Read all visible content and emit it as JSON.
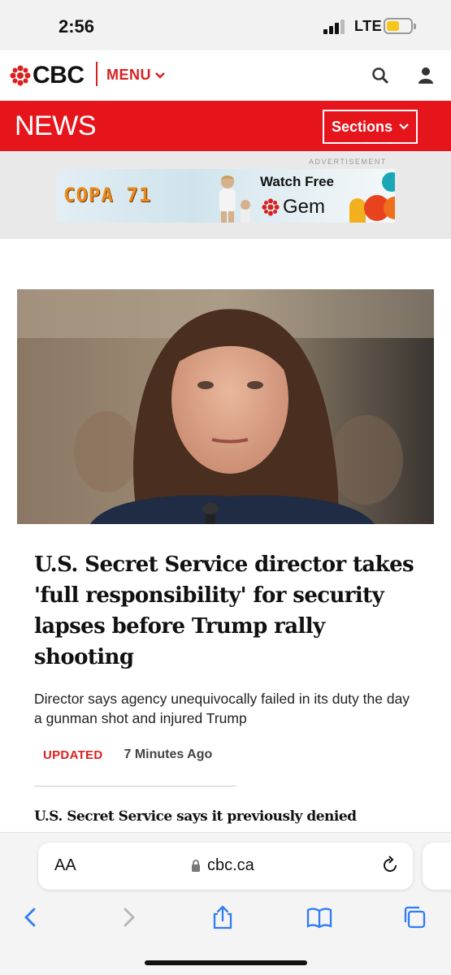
{
  "status_bar": {
    "time": "2:56",
    "network": "LTE",
    "battery_level": 0.55,
    "battery_color": "#f6c61a"
  },
  "header": {
    "logo_text": "CBC",
    "menu_label": "MENU",
    "brand_color": "#d9201f",
    "icons": [
      "search-icon",
      "user-icon"
    ]
  },
  "news_bar": {
    "title": "NEWS",
    "sections_label": "Sections",
    "bar_color": "#e6141b"
  },
  "advertisement": {
    "label": "ADVERTISEMENT",
    "banner_title": "COPA 71",
    "banner_cta": "Watch Free",
    "banner_brand": "Gem"
  },
  "article": {
    "image_alt": "Woman with long brown hair seated at a hearing microphone",
    "headline": "U.S. Secret Service director takes 'full responsibility' for security lapses before Trump rally shooting",
    "deck": "Director says agency unequivocally failed in its duty the day a gunman shot and injured Trump",
    "status": "UPDATED",
    "time_ago": "7 Minutes Ago"
  },
  "next_story": {
    "headline": "U.S. Secret Service says it previously denied"
  },
  "browser": {
    "text_size_label": "AA",
    "url": "cbc.ca",
    "toolbar": [
      "back-icon",
      "forward-icon",
      "share-icon",
      "bookmarks-icon",
      "tabs-icon"
    ]
  }
}
